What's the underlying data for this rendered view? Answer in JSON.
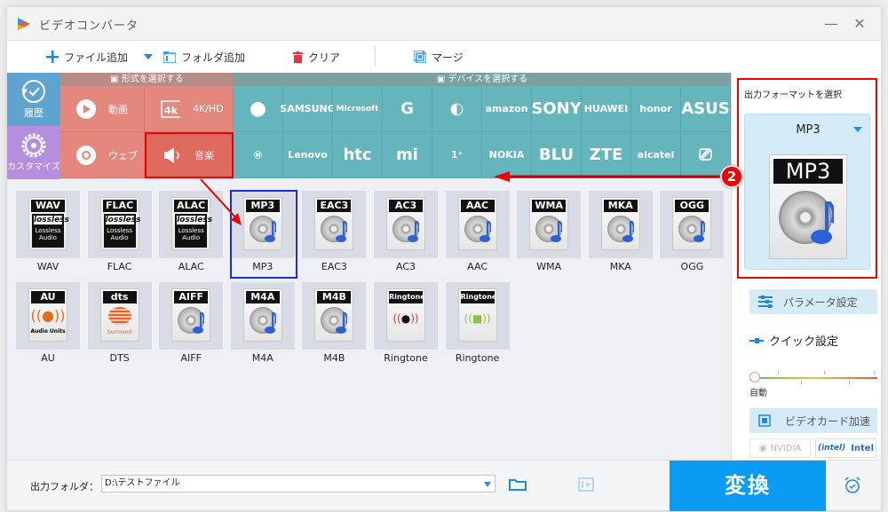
{
  "window": {
    "title": "ビデオコンバータ",
    "minimize_icon": "minimize-icon",
    "close_icon": "close-icon"
  },
  "toolbar": {
    "add_file": "ファイル追加",
    "add_folder": "フォルダ追加",
    "clear": "クリア",
    "merge": "マージ"
  },
  "sidebar": {
    "history": "履歴",
    "customize": "カスタマイズ"
  },
  "format_section": {
    "header": "形式を選択する",
    "categories": [
      {
        "label": "動画",
        "icon": "play-icon"
      },
      {
        "label": "4K/HD",
        "icon": "4k-icon"
      },
      {
        "label": "ウェブ",
        "icon": "chrome-icon"
      },
      {
        "label": "音楽",
        "icon": "speaker-icon",
        "selected": true
      }
    ]
  },
  "device_section": {
    "header": "デバイスを選択する",
    "row1": [
      "Apple",
      "SAMSUNG",
      "Microsoft",
      "G",
      "LG",
      "amazon",
      "SONY",
      "HUAWEI",
      "honor",
      "ASUS"
    ],
    "row2": [
      "Motorola",
      "Lenovo",
      "htc",
      "mi",
      "OnePlus",
      "NOKIA",
      "BLU",
      "ZTE",
      "alcatel",
      "TV"
    ]
  },
  "formats": [
    {
      "label": "WAV",
      "band": "WAV",
      "art": "lossless"
    },
    {
      "label": "FLAC",
      "band": "FLAC",
      "art": "lossless"
    },
    {
      "label": "ALAC",
      "band": "ALAC",
      "art": "lossless"
    },
    {
      "label": "MP3",
      "band": "MP3",
      "art": "disc",
      "selected": true
    },
    {
      "label": "EAC3",
      "band": "EAC3",
      "art": "disc"
    },
    {
      "label": "AC3",
      "band": "AC3",
      "art": "disc"
    },
    {
      "label": "AAC",
      "band": "AAC",
      "art": "disc"
    },
    {
      "label": "WMA",
      "band": "WMA",
      "art": "disc"
    },
    {
      "label": "MKA",
      "band": "MKA",
      "art": "disc"
    },
    {
      "label": "OGG",
      "band": "OGG",
      "art": "disc"
    },
    {
      "label": "AU",
      "band": "AU",
      "art": "audio-units"
    },
    {
      "label": "DTS",
      "band": "dts",
      "art": "surround"
    },
    {
      "label": "AIFF",
      "band": "AIFF",
      "art": "disc"
    },
    {
      "label": "M4A",
      "band": "M4A",
      "art": "disc"
    },
    {
      "label": "M4B",
      "band": "M4B",
      "art": "disc"
    },
    {
      "label": "Ringtone",
      "band": "Ringtone",
      "art": "apple"
    },
    {
      "label": "Ringtone",
      "band": "Ringtone",
      "art": "android"
    }
  ],
  "lossless_text": {
    "logo": "lossless",
    "line1": "Lossless",
    "line2": "Audio"
  },
  "au_text": "Audio Units",
  "dts_text": "Surround",
  "output_panel": {
    "title": "出力フォーマットを選択",
    "selected_format": "MP3",
    "preview_band": "MP3",
    "param_settings": "パラメータ設定",
    "quick_settings": "クイック設定",
    "quality_label": "自動",
    "quality_value": 0,
    "gpu_accel": "ビデオカード加速",
    "nvidia": "NVIDIA",
    "intel": "Intel"
  },
  "annotation": {
    "badge": "2"
  },
  "bottom": {
    "output_folder_label": "出力フォルダ：",
    "output_folder_value": "D:\\テストファイル",
    "convert": "変換"
  },
  "colors": {
    "accent": "#0b9bf3",
    "format_tiles": "#e4877d",
    "device_tiles": "#65b5bd",
    "history": "#5fa3d1",
    "customize": "#b58ee0",
    "highlight": "#ee0000"
  }
}
